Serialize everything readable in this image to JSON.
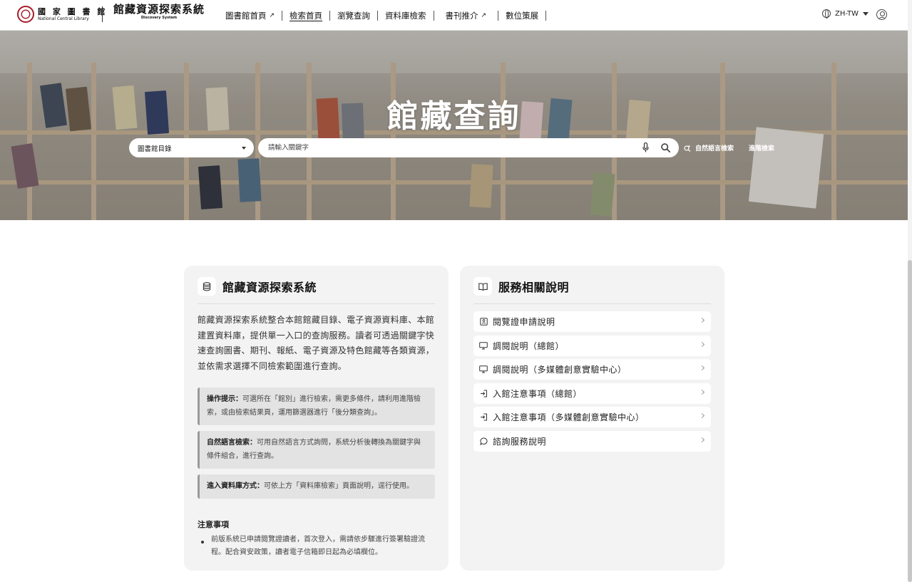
{
  "header": {
    "logo_zh": "國 家 圖 書 館",
    "logo_en": "National Central Library",
    "system_title_zh": "館藏資源探索系統",
    "system_title_en": "Discovery System",
    "nav": [
      {
        "label": "圖書館首頁",
        "external": true,
        "active": false
      },
      {
        "label": "檢索首頁",
        "external": false,
        "active": true
      },
      {
        "label": "瀏覽查詢",
        "external": false,
        "active": false
      },
      {
        "label": "資料庫檢索",
        "external": false,
        "active": false
      },
      {
        "label": "書刊推介",
        "external": true,
        "active": false
      },
      {
        "label": "數位策展",
        "external": false,
        "active": false
      }
    ],
    "language": "ZH-TW",
    "icons": {
      "language": "globe-icon",
      "account": "user-circle-icon",
      "external": "arrow-up-right-icon"
    }
  },
  "hero": {
    "title": "館藏查詢",
    "scope_select": {
      "value": "圖書館目錄"
    },
    "search": {
      "placeholder": "請輸入關鍵字",
      "value": ""
    },
    "natural_language_label": "自然語言檢索",
    "advanced_label": "進階檢索"
  },
  "left_card": {
    "title": "館藏資源探索系統",
    "icon": "database-icon",
    "intro": "館藏資源探索系統整合本館館藏目錄、電子資源資料庫、本館建置資料庫，提供單一入口的查詢服務。讀者可透過關鍵字快速查詢圖書、期刊、報紙、電子資源及特色館藏等各類資源，並依需求選擇不同檢索範圍進行查詢。",
    "tips": [
      {
        "label": "操作提示：",
        "text": "可選所在「館別」進行檢索，需更多條件，請利用進階檢索，或由檢索結果頁，運用篩選器進行「後分類查詢」。"
      },
      {
        "label": "自然語言檢索：",
        "text": "可用自然語言方式詢問，系統分析後轉換為關鍵字與條件組合，進行查詢。"
      },
      {
        "label": "進入資料庫方式：",
        "text": "可依上方「資料庫檢索」頁面說明，逕行使用。"
      }
    ],
    "notes_title": "注意事項",
    "notes": [
      "前版系統已申請閱覽證讀者，首次登入，需請依步驟進行簽署驗證流程。配合資安政策，讀者電子信箱即日起為必填欄位。"
    ]
  },
  "right_card": {
    "title": "服務相關說明",
    "icon": "book-open-icon",
    "items": [
      {
        "label": "閱覽證申請說明",
        "icon": "id-card-icon"
      },
      {
        "label": "調閱說明（總館）",
        "icon": "monitor-icon"
      },
      {
        "label": "調閱說明（多媒體創意實驗中心）",
        "icon": "monitor-icon"
      },
      {
        "label": "入館注意事項（總館）",
        "icon": "sign-in-icon"
      },
      {
        "label": "入館注意事項（多媒體創意實驗中心）",
        "icon": "sign-in-icon"
      },
      {
        "label": "諮詢服務說明",
        "icon": "chat-bubble-icon"
      }
    ]
  }
}
